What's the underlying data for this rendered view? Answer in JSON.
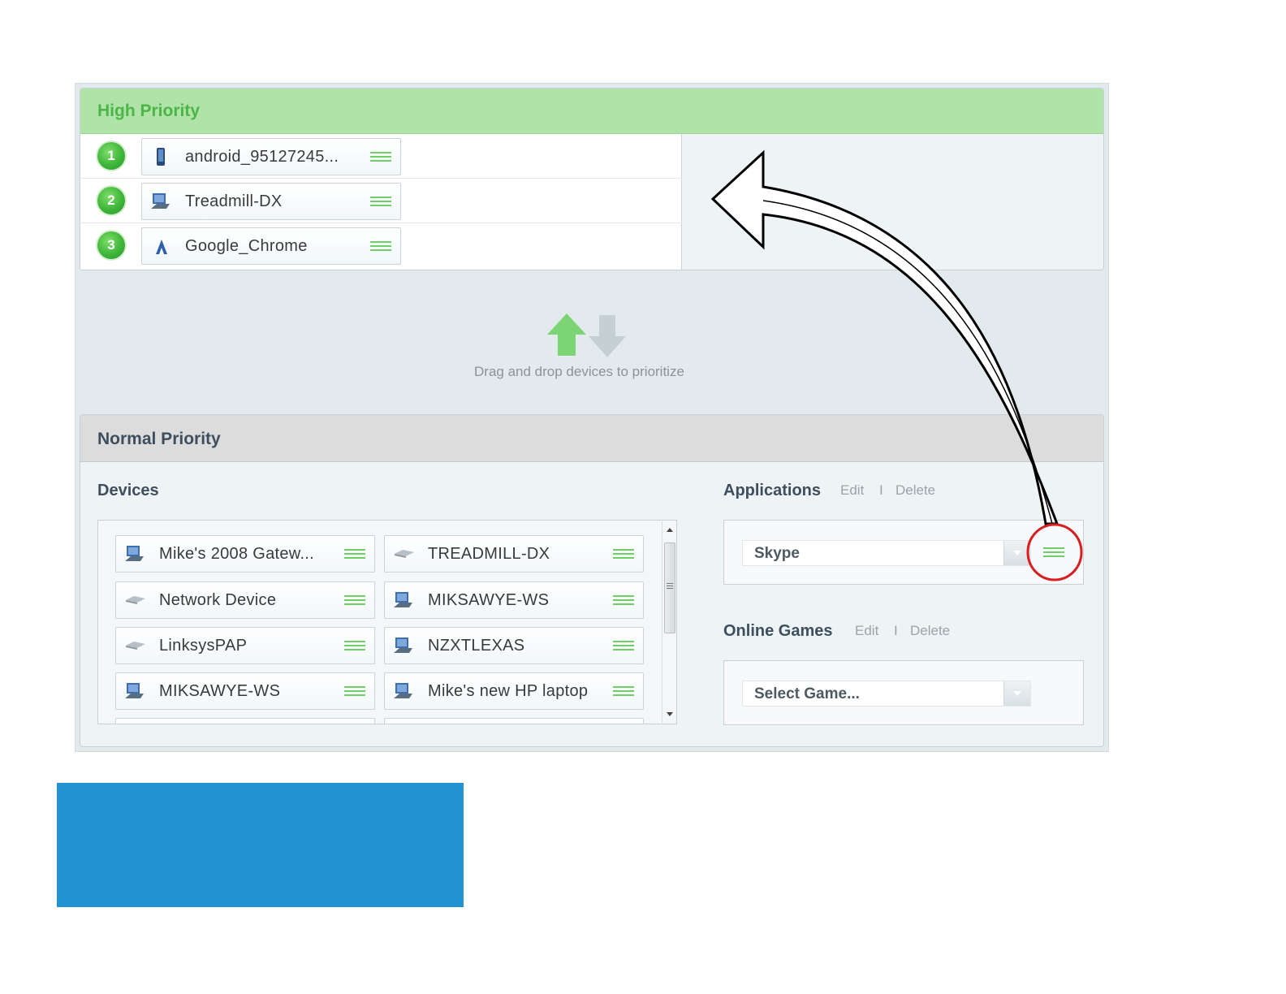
{
  "high_priority": {
    "title": "High Priority",
    "devices": [
      {
        "rank": "1",
        "name": "android_95127245...",
        "icon": "phone-icon"
      },
      {
        "rank": "2",
        "name": "Treadmill-DX",
        "icon": "computer-icon"
      },
      {
        "rank": "3",
        "name": "Google_Chrome",
        "icon": "application-icon"
      }
    ]
  },
  "hint": {
    "text": "Drag and drop devices to prioritize",
    "up_color": "#7dd474",
    "down_color": "#c5d0d5"
  },
  "normal_priority": {
    "title": "Normal Priority",
    "devices_label": "Devices",
    "devices": [
      {
        "name": "Mike's 2008 Gatew...",
        "icon": "computer-icon"
      },
      {
        "name": "TREADMILL-DX",
        "icon": "network-device-icon"
      },
      {
        "name": "Network Device",
        "icon": "network-device-icon"
      },
      {
        "name": "MIKSAWYE-WS",
        "icon": "computer-icon"
      },
      {
        "name": "LinksysPAP",
        "icon": "network-device-icon"
      },
      {
        "name": "NZXTLEXAS",
        "icon": "computer-icon"
      },
      {
        "name": "MIKSAWYE-WS",
        "icon": "computer-icon"
      },
      {
        "name": "Mike's new HP laptop",
        "icon": "computer-icon"
      }
    ],
    "applications": {
      "label": "Applications",
      "edit": "Edit",
      "separator": "I",
      "delete": "Delete",
      "selected": "Skype"
    },
    "online_games": {
      "label": "Online Games",
      "edit": "Edit",
      "separator": "I",
      "delete": "Delete",
      "selected": "Select Game..."
    }
  },
  "colors": {
    "high_header": "#b0e3a8",
    "high_title": "#4cb547",
    "handle": "#6fcf67",
    "annotation_circle": "#d81e1e",
    "blue_block": "#2292d1"
  }
}
